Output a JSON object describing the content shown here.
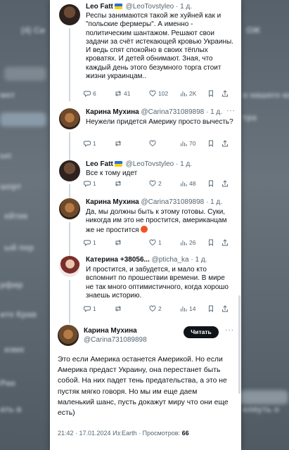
{
  "background": {
    "rows": [
      "(4) Си",
      "ОЖ",
      "мет",
      "о нашего ка",
      "ыс",
      "тра",
      "шорт",
      "б",
      "ейтик ",
      "ый пер",
      "рфир",
      "ите Крав",
      "изме",
      "Рие",
      "ать в",
      "еляуть о"
    ]
  },
  "tweets": [
    {
      "name": "Leo Fatt",
      "handle": "@LeoTovstyleo",
      "time": "· 1 д.",
      "text": "Респы занимаются такой же хуйней как и \"польские фермеры\". А именно - политическим шантажом. Решают свои задачи за счёт истекающей кровью Украины. И ведь спят спокойно в своих тёплых кроватях. И детей обнимают. Зная, что каждый день этого безумного торга стоит жизни украинцам..",
      "stats": {
        "reply": "6",
        "retweet": "41",
        "like": "102",
        "views": "2K"
      }
    },
    {
      "name": "Карина Мухина",
      "handle": "@Carina731089898",
      "time": "· 1 д.",
      "text": "Неужели придется Америку просто вычесть?",
      "stats": {
        "reply": "1",
        "retweet": "",
        "like": "",
        "views": "70"
      }
    },
    {
      "name": "Leo Fatt",
      "handle": "@LeoTovstyleo",
      "time": "· 1 д.",
      "text": "Все к тому идет",
      "stats": {
        "reply": "1",
        "retweet": "",
        "like": "2",
        "views": "48"
      }
    },
    {
      "name": "Карина Мухина",
      "handle": "@Carina731089898",
      "time": "· 1 д.",
      "text": "Да, мы должны быть к этому готовы. Суки, никогда им это не простится, американцам же не простится",
      "stats": {
        "reply": "1",
        "retweet": "",
        "like": "1",
        "views": "26"
      }
    },
    {
      "name": "Катерина +38056...",
      "handle": "@pticha_ka",
      "time": "· 1 д.",
      "text": "И простится, и забудется, и мало кто вспомнит по прошествии времени. В мире не так много оптимистичного, когда хорошо знаешь историю.",
      "stats": {
        "reply": "1",
        "retweet": "",
        "like": "2",
        "views": "14"
      }
    }
  ],
  "main": {
    "name": "Карина Мухина",
    "handle": "@Carina731089898",
    "follow_label": "Читать",
    "text": "Это если Америка останется Америкой. Но если Америка предаст Украину, она перестанет быть собой. На них падет тень предательства, а это не пустяк мягко говоря. Но мы им еще даем маленький шанс, пусть докажут миру что они еще есть)",
    "timestamp": "21:42 · 17.01.2024 Из:Earth · Просмотров:",
    "views": "66"
  },
  "colors": {
    "text": "#0f1419",
    "muted": "#536471",
    "line": "#cfd9de",
    "flag_blue": "#2b6fd6",
    "flag_yellow": "#f5d10a"
  }
}
